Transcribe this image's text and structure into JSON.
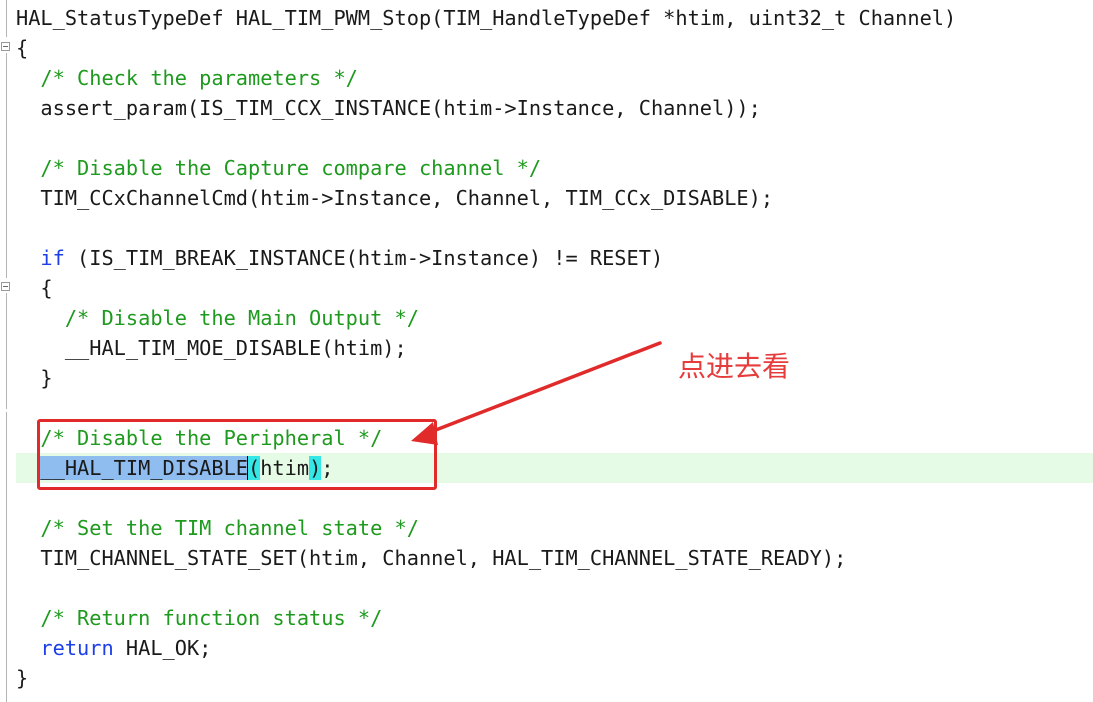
{
  "code": {
    "signature": "HAL_StatusTypeDef HAL_TIM_PWM_Stop(TIM_HandleTypeDef *htim, uint32_t Channel)",
    "open_brace": "{",
    "comment_check": "  /* Check the parameters */",
    "assert_line": "  assert_param(IS_TIM_CCX_INSTANCE(htim->Instance, Channel));",
    "comment_disable_capture": "  /* Disable the Capture compare channel */",
    "ccx_cmd_line": "  TIM_CCxChannelCmd(htim->Instance, Channel, TIM_CCx_DISABLE);",
    "if_keyword": "  if",
    "if_condition": " (IS_TIM_BREAK_INSTANCE(htim->Instance) != RESET)",
    "if_open_brace": "  {",
    "comment_main_output": "    /* Disable the Main Output */",
    "moe_disable_line": "    __HAL_TIM_MOE_DISABLE(htim);",
    "if_close_brace": "  }",
    "comment_peripheral": "  /* Disable the Peripheral */",
    "disable_indent": "  ",
    "disable_macro": "__HAL_TIM_DISABLE",
    "disable_open_paren": "(",
    "disable_arg": "htim",
    "disable_close_paren": ")",
    "disable_semicolon": ";",
    "comment_set_state": "  /* Set the TIM channel state */",
    "state_set_line": "  TIM_CHANNEL_STATE_SET(htim, Channel, HAL_TIM_CHANNEL_STATE_READY);",
    "comment_return": "  /* Return function status */",
    "return_keyword": "  return",
    "return_value": " HAL_OK;",
    "close_brace": "}"
  },
  "annotation": {
    "text": "点进去看",
    "color": "#e63c3c"
  },
  "colors": {
    "comment": "#1e9a1e",
    "keyword": "#1c3fe8",
    "selection": "#8fbdf0",
    "brace_match": "#35e6e6",
    "current_line": "#e6fbe6",
    "highlight_box": "#e12a2a"
  }
}
